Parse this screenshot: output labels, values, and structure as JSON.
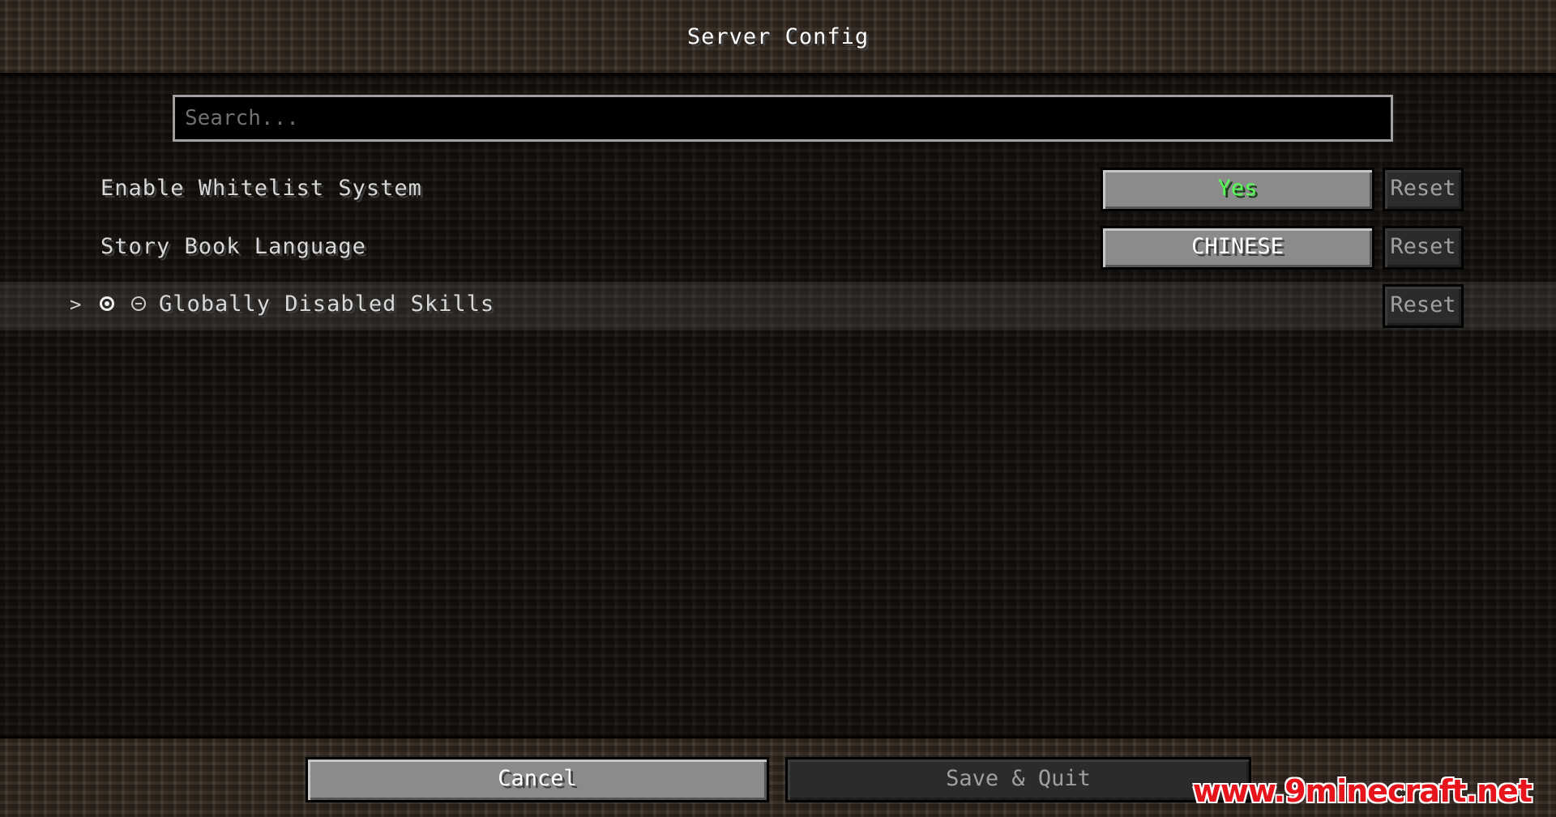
{
  "window": {
    "title": "Server Config"
  },
  "search": {
    "placeholder": "Search..."
  },
  "entries": [
    {
      "label": "Enable Whitelist System",
      "value": "Yes",
      "reset_label": "Reset"
    },
    {
      "label": "Story Book Language",
      "value": "CHINESE",
      "reset_label": "Reset"
    },
    {
      "label": "Globally Disabled Skills",
      "reset_label": "Reset",
      "expand_glyph": ">"
    }
  ],
  "footer": {
    "cancel_label": "Cancel",
    "save_label": "Save & Quit"
  },
  "watermark": "www.9minecraft.net",
  "colors": {
    "value_yes": "#55ff55",
    "watermark": "#e8141b"
  }
}
